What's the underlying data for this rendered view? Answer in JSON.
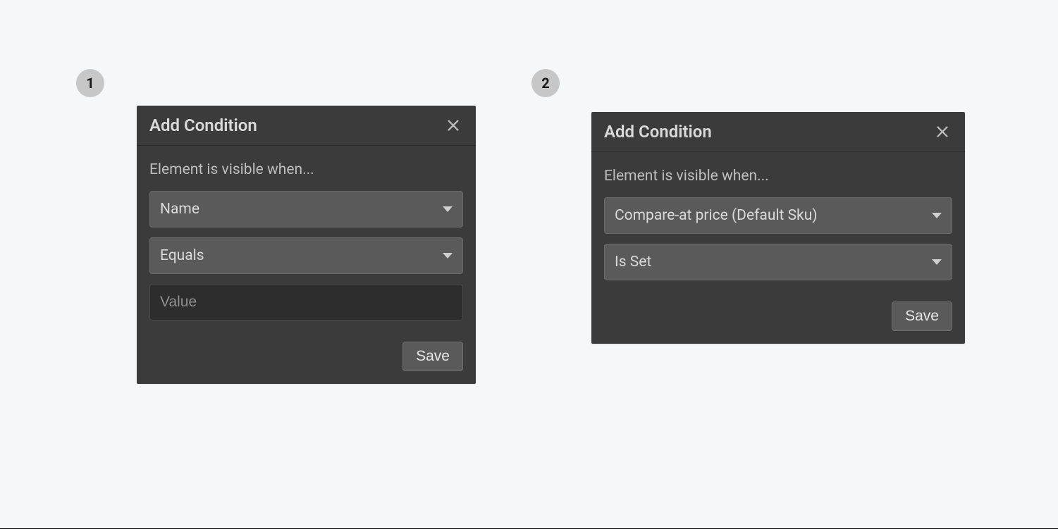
{
  "badges": {
    "one": "1",
    "two": "2"
  },
  "dialog1": {
    "title": "Add Condition",
    "prompt": "Element is visible when...",
    "field_select": "Name",
    "operator_select": "Equals",
    "value_placeholder": "Value",
    "save_label": "Save"
  },
  "dialog2": {
    "title": "Add Condition",
    "prompt": "Element is visible when...",
    "field_select": "Compare-at price (Default Sku)",
    "operator_select": "Is Set",
    "save_label": "Save"
  }
}
